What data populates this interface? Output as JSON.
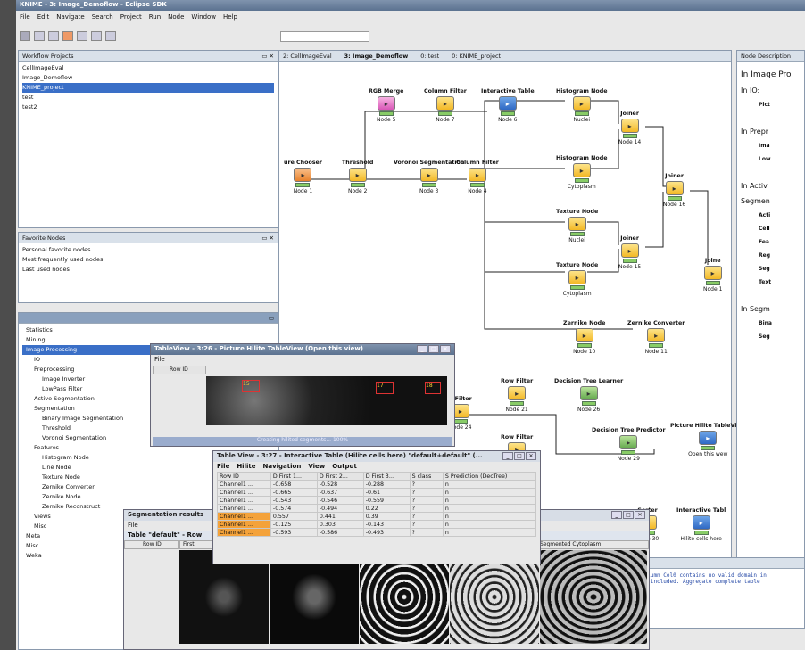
{
  "app": {
    "title": "KNIME - 3: Image_Demoflow - Eclipse SDK",
    "menu": [
      "File",
      "Edit",
      "Navigate",
      "Search",
      "Project",
      "Run",
      "Node",
      "Window",
      "Help"
    ]
  },
  "workflow_projects": {
    "header": "Workflow Projects",
    "items": [
      "CellImageEval",
      "Image_Demoflow",
      "KNIME_project",
      "test",
      "test2"
    ]
  },
  "favorites": {
    "header": "Favorite Nodes",
    "items": [
      "Personal favorite nodes",
      "Most frequently used nodes",
      "Last used nodes"
    ]
  },
  "repository": {
    "items": [
      "Statistics",
      "Mining",
      "Image Processing",
      "IO",
      "Preprocessing",
      "Image Inverter",
      "LowPass Filter",
      "Active Segmentation",
      "Segmentation",
      "Binary Image Segmentation",
      "Threshold",
      "Voronoi Segmentation",
      "Features",
      "Histogram Node",
      "Line Node",
      "Texture Node",
      "Zernike Converter",
      "Zernike Node",
      "Zernike Reconstruct",
      "Views",
      "Misc",
      "Meta",
      "Misc",
      "Weka"
    ]
  },
  "editor_tabs": [
    "2: CellImageEval",
    "3: Image_Demoflow",
    "0: test",
    "0: KNIME_project"
  ],
  "node_description": {
    "header": "Node Description",
    "lines": [
      "In Image Pro",
      "In IO:",
      "Pict",
      "In Prepr",
      "Ima",
      "Low",
      "In Activ",
      "Segmen",
      "Acti",
      "Cell",
      "Fea",
      "Reg",
      "Seg",
      "Text",
      "In Segm",
      "Bina",
      "Seg"
    ]
  },
  "nodes": [
    {
      "label": "RGB Merge",
      "id": "Node 5"
    },
    {
      "label": "Column Filter",
      "id": "Node 7"
    },
    {
      "label": "Interactive Table",
      "id": "Node 6"
    },
    {
      "label": "Histogram Node",
      "id": "Nuclei"
    },
    {
      "label": "Histogram Node",
      "id": "Cytoplasm"
    },
    {
      "label": "Joiner",
      "id": "Node 14"
    },
    {
      "label": "Joiner",
      "id": "Node 16"
    },
    {
      "label": "ure Chooser",
      "id": "Node 1"
    },
    {
      "label": "Threshold",
      "id": "Node 2"
    },
    {
      "label": "Voronoi Segmentation",
      "id": "Node 3"
    },
    {
      "label": "Column Filter",
      "id": "Node 4"
    },
    {
      "label": "Texture Node",
      "id": "Nuclei"
    },
    {
      "label": "Texture Node",
      "id": "Cytoplasm"
    },
    {
      "label": "Joiner",
      "id": "Node 15"
    },
    {
      "label": "Joine",
      "id": "Node 1"
    },
    {
      "label": "Zernike Node",
      "id": "Node 10"
    },
    {
      "label": "Zernike Converter",
      "id": "Node 11"
    },
    {
      "label": "Row Filter",
      "id": "Node 21"
    },
    {
      "label": "Decision Tree Learner",
      "id": "Node 26"
    },
    {
      "label": "Row Filter",
      "id": "Node 24"
    },
    {
      "label": "Decision Tree Predictor",
      "id": "Node 29"
    },
    {
      "label": "Picture Hilite TableView",
      "id": "Open this wew"
    },
    {
      "label": "Sorter",
      "id": "Node 30"
    },
    {
      "label": "Interactive Tabl",
      "id": "Hilite cells here"
    },
    {
      "label": "n Filter",
      "id": "Node 24"
    }
  ],
  "tableview": {
    "title": "TableView - 3:26 - Picture Hilite TableView (Open this view)",
    "menu": "File",
    "col": "Row ID",
    "status": "Creating hilited segments... 100%",
    "labels": [
      "15",
      "17",
      "18"
    ]
  },
  "interactive": {
    "title": "Table View - 3:27 - Interactive Table (Hilite cells here) \"default+default\" (...",
    "menu": [
      "File",
      "Hilite",
      "Navigation",
      "View",
      "Output"
    ],
    "columns": [
      "Row ID",
      "D First 1...",
      "D First 2...",
      "D First 3...",
      "S class",
      "S Prediction (DecTree)"
    ],
    "rows": [
      [
        "Channel1 ...",
        "-0.658",
        "-0.528",
        "-0.288",
        "?",
        "n"
      ],
      [
        "Channel1 ...",
        "-0.665",
        "-0.637",
        "-0.61",
        "?",
        "n"
      ],
      [
        "Channel1 ...",
        "-0.543",
        "-0.546",
        "-0.559",
        "?",
        "n"
      ],
      [
        "Channel1 ...",
        "-0.574",
        "-0.494",
        "0.22",
        "?",
        "n"
      ],
      [
        "Channel1 ...",
        "0.557",
        "0.441",
        "0.39",
        "?",
        "n"
      ],
      [
        "Channel1 ...",
        "-0.125",
        "0.303",
        "-0.143",
        "?",
        "n"
      ],
      [
        "Channel1 ...",
        "-0.593",
        "-0.586",
        "-0.493",
        "?",
        "n"
      ]
    ]
  },
  "segmentation": {
    "title": "Segmentation results",
    "menu": "File",
    "table": "Table \"default\" - Row",
    "cols": [
      "Row ID",
      "First",
      "Segmented Cytoplasm"
    ]
  },
  "console": {
    "lines": [
      "column Col0 contains no valid domain in",
      "en included. Aggregate complete table"
    ]
  }
}
